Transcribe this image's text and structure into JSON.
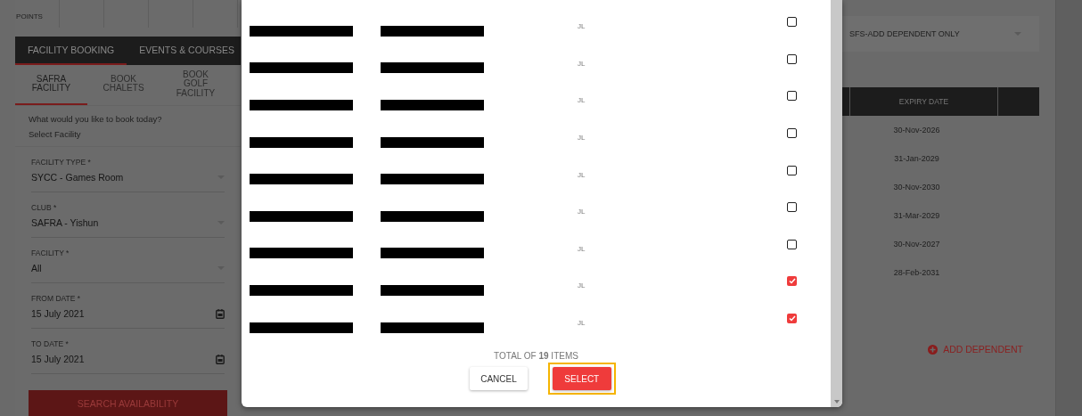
{
  "points_strip": {
    "label": "POINTS"
  },
  "booking_tabs": [
    {
      "label": "FACILITY BOOKING",
      "selected": true
    },
    {
      "label": "EVENTS & COURSES",
      "selected": false
    }
  ],
  "sub_tabs": [
    {
      "label": "SAFRA FACILITY",
      "selected": true
    },
    {
      "label": "BOOK CHALETS",
      "selected": false
    },
    {
      "label": "BOOK GOLF FACILITY",
      "selected": false
    }
  ],
  "prompt": "What would you like to book today?",
  "section": "Select Facility",
  "fields": [
    {
      "kind": "select",
      "label": "FACILITY TYPE *",
      "value": "SYCC - Games Room"
    },
    {
      "kind": "select",
      "label": "CLUB *",
      "value": "SAFRA - Yishun"
    },
    {
      "kind": "select",
      "label": "FACILITY *",
      "value": "All"
    },
    {
      "kind": "date",
      "label": "FROM DATE *",
      "value": "15 July 2021"
    },
    {
      "kind": "date",
      "label": "TO DATE *",
      "value": "15 July 2021"
    }
  ],
  "search_button": "SEARCH AVAILABILITY",
  "membership_select": {
    "value": "SFS-ADD DEPENDENT ONLY"
  },
  "table": {
    "columns": [
      "EXPIRY DATE"
    ],
    "rows": [
      "30-Nov-2026",
      "31-Jan-2029",
      "30-Nov-2030",
      "31-Mar-2029",
      "30-Nov-2027",
      "28-Feb-2031"
    ]
  },
  "add_dependent": "ADD DEPENDENT",
  "dialog": {
    "rows": [
      {
        "column_3": "JL",
        "checked": false
      },
      {
        "column_3": "JL",
        "checked": false
      },
      {
        "column_3": "JL",
        "checked": false
      },
      {
        "column_3": "JL",
        "checked": false
      },
      {
        "column_3": "JL",
        "checked": false
      },
      {
        "column_3": "JL",
        "checked": false
      },
      {
        "column_3": "JL",
        "checked": false
      },
      {
        "column_3": "JL",
        "checked": true
      },
      {
        "column_3": "JL",
        "checked": true
      }
    ],
    "total": "TOTAL OF **19** ITEMS",
    "buttons": [
      {
        "kind": "secondary",
        "label": "CANCEL",
        "highlighted": false
      },
      {
        "kind": "primary",
        "label": "SELECT",
        "highlighted": true
      }
    ]
  }
}
